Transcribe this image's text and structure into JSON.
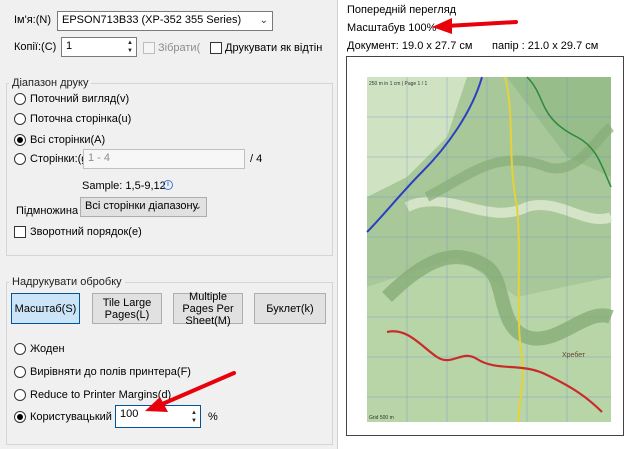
{
  "printer": {
    "name_label": "Ім'я:(N)",
    "name_value": "EPSON713B33 (XP-352 355 Series)",
    "copies_label": "Копії:(C)",
    "copies_value": "1",
    "collate_label": "Зібрати(",
    "print_as_image_label": "Друкувати як відтін"
  },
  "range": {
    "title": "Діапазон друку",
    "current_view": "Поточний вигляд(v)",
    "current_page": "Поточна сторінка(u)",
    "all_pages": "Всі сторінки(A)",
    "pages": "Сторінки:(g",
    "pages_placeholder": "1 - 4",
    "pages_total": "/ 4",
    "sample": "Sample: 1,5-9,12",
    "subset_label": "Підмножина",
    "subset_value": "Всі сторінки діапазону",
    "reverse": "Зворотний порядок(e)"
  },
  "handling": {
    "title": "Надрукувати обробку",
    "buttons": [
      "Масштаб(S)",
      "Tile Large Pages(L)",
      "Multiple Pages Per Sheet(M)",
      "Буклет(k)"
    ],
    "none": "Жоден",
    "fit_printer": "Вирівняти до полів принтера(F)",
    "reduce": "Reduce to Printer Margins(d)",
    "custom": "Користувацький м",
    "custom_value": "100",
    "percent": "%"
  },
  "preview": {
    "title": "Попередній перегляд",
    "zoom": "Масштабув 100%",
    "document": "Документ:  19.0 x 27.7 см",
    "paper": "папір :  21.0 x 29.7 см"
  },
  "map": {
    "header_text": "250 m in 1 cm | Page 1 / 1",
    "footer_text": "Grid 500 m",
    "place_label": "Хребет"
  },
  "colors": {
    "arrow": "#e8000b",
    "accent": "#005499"
  }
}
